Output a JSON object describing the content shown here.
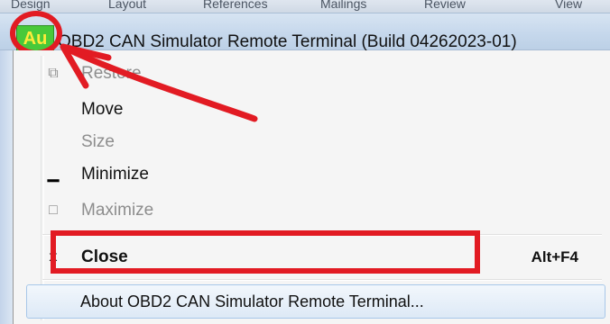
{
  "background_ribbon": {
    "tabs": [
      "Design",
      "Layout",
      "References",
      "Mailings",
      "Review",
      "View"
    ]
  },
  "titlebar": {
    "icon_text": "Au",
    "title": "OBD2 CAN Simulator Remote Terminal (Build 04262023-01)"
  },
  "menu": {
    "items": [
      {
        "label": "Restore",
        "icon": "restore-icon",
        "glyph": "⧉",
        "enabled": false
      },
      {
        "label": "Move",
        "icon": "",
        "glyph": "",
        "enabled": true
      },
      {
        "label": "Size",
        "icon": "",
        "glyph": "",
        "enabled": false
      },
      {
        "label": "Minimize",
        "icon": "minimize-icon",
        "glyph": "▁",
        "enabled": true
      },
      {
        "label": "Maximize",
        "icon": "maximize-icon",
        "glyph": "□",
        "enabled": false
      },
      {
        "label": "Close",
        "icon": "close-icon",
        "glyph": "x",
        "enabled": true,
        "accelerator": "Alt+F4"
      },
      {
        "label": "About OBD2 CAN Simulator Remote Terminal...",
        "icon": "",
        "glyph": "",
        "enabled": true
      }
    ]
  },
  "annotation_colors": {
    "markup_red": "#e21b23",
    "icon_green": "#48c93a",
    "icon_text_yellow": "#ffeb3b"
  }
}
